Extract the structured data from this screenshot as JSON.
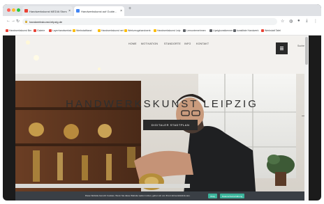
{
  "browser": {
    "tabs": [
      {
        "label": "Handwerkskunst MEDIA Stors",
        "favicon_color": "#e94235",
        "active": false
      },
      {
        "label": "Handwerkskunst auf Guide...",
        "favicon_color": "#4285f4",
        "active": true
      }
    ],
    "new_tab_icon": "plus-icon",
    "url": "handwerkskunst-leipzig.de",
    "bookmarks": [
      {
        "label": "Handwerkskunst Ber",
        "color": "#e94235"
      },
      {
        "label": "Galerie",
        "color": "#e94235"
      },
      {
        "label": "Layerhandwerksk",
        "color": "#ea4335"
      },
      {
        "label": "Werkstatthand",
        "color": "#fbbc05"
      },
      {
        "label": "Handwerkskunst net",
        "color": "#fbbc05"
      },
      {
        "label": "Werkzeugshandwerk",
        "color": "#fbbc05"
      },
      {
        "label": "Handwerkskunst Leip",
        "color": "#fbbc05"
      },
      {
        "label": "Lernunternehmen",
        "color": "#5f6368"
      },
      {
        "label": "Lipzigkunstkenner",
        "color": "#5f6368"
      },
      {
        "label": "kunstliste Handwerk",
        "color": "#5f6368"
      },
      {
        "label": "Werkstatt Tafel",
        "color": "#e94235"
      }
    ]
  },
  "site": {
    "nav": [
      "HOME",
      "MOTIVATION",
      "STANDORTE",
      "INFO",
      "KONTAKT"
    ],
    "menu_icon": "hamburger-menu-icon",
    "language": "Suche",
    "hero_title": "HANDWERKSKUNST LEIPZIG",
    "cta_label": "DIGITALER STADTPLAN",
    "next_icon": "arrow-right-icon",
    "cookie_text": "Diese Website benutzt Cookies. Wenn Sie diese Website weiter nutzen, gehen wir von Ihrem Einverständnis aus.",
    "cookie_ok": "Okay",
    "cookie_privacy": "Datenschutzerklärung",
    "accent": "#3bb39b"
  }
}
